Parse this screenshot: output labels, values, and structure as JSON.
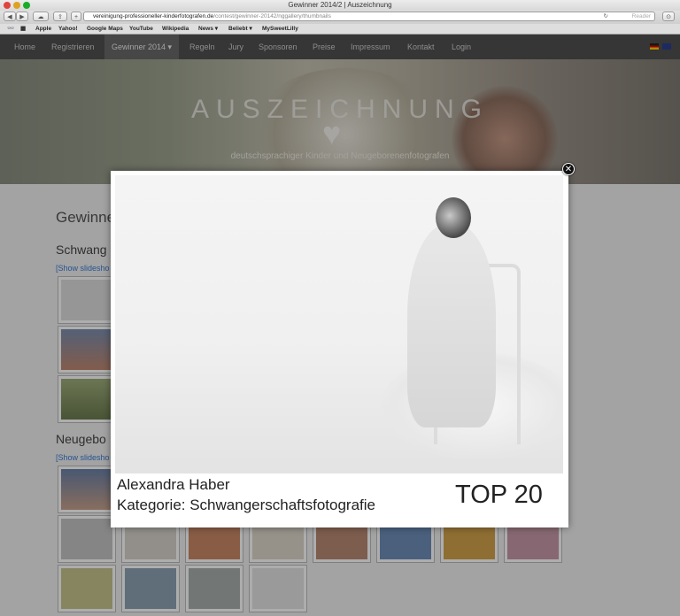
{
  "browser": {
    "title": "Gewinner 2014/2 | Auszeichnung",
    "url_domain": "vereinigung-professioneller-kinderfotografen.de",
    "url_path": "/contest/gewinner-20142/nggallery/thumbnails",
    "reader_label": "Reader",
    "bookmarks": [
      "Apple",
      "Yahoo!",
      "Google Maps",
      "YouTube",
      "Wikipedia",
      "News ▾",
      "Beliebt ▾",
      "MySweetLilly"
    ]
  },
  "nav": {
    "items": [
      "Home",
      "Registrieren",
      "Gewinner 2014 ▾",
      "Regeln",
      "Jury",
      "Sponsoren",
      "Preise",
      "Impressum",
      "Kontakt",
      "Login"
    ]
  },
  "hero": {
    "title": "AUSZEICHNUNG",
    "subtitle": "deutschsprachiger Kinder und Neugeborenenfotografen"
  },
  "page": {
    "heading": "Gewinner",
    "section1": "Schwang",
    "section2": "Neugebo",
    "slideshow_link": "[Show slidesho"
  },
  "lightbox": {
    "name": "Alexandra Haber",
    "category": "Kategorie: Schwangerschaftsfotografie",
    "rank": "TOP 20",
    "close_icon": "✕"
  },
  "colors": {
    "nav_bg": "#4f504e",
    "link": "#3a7bd5"
  }
}
